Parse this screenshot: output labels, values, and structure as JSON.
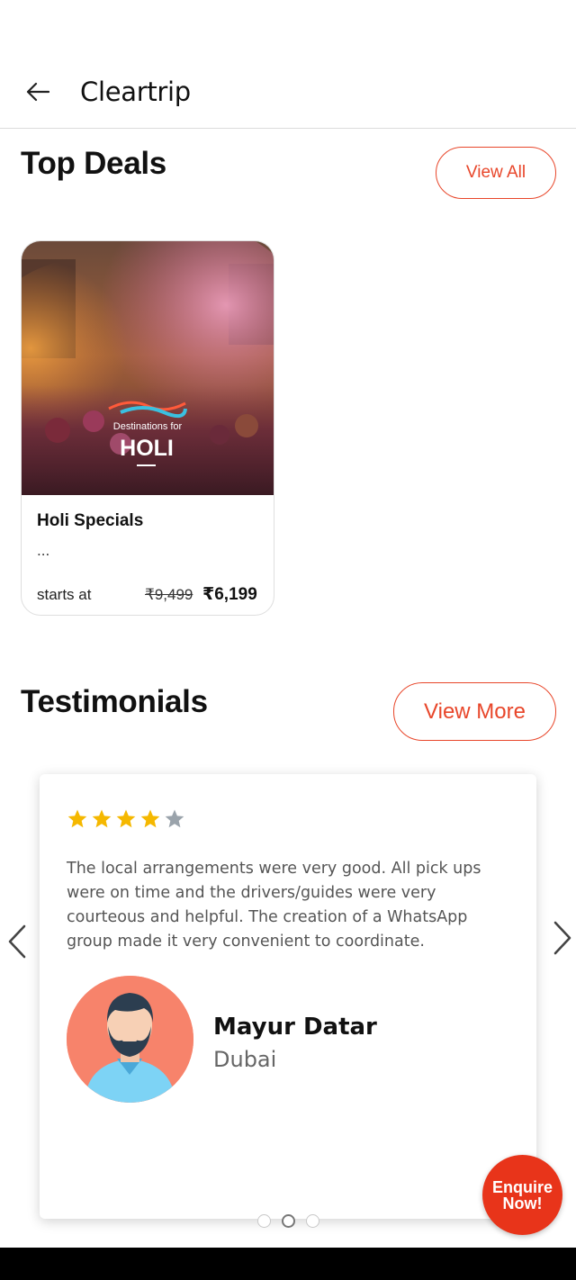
{
  "header": {
    "title": "Cleartrip"
  },
  "top_deals": {
    "title": "Top Deals",
    "view_all_label": "View All",
    "deals": [
      {
        "image_caption_small": "Destinations for",
        "image_caption_large": "HOLI",
        "name": "Holi Specials",
        "description": "...",
        "starts_label": "starts at",
        "old_price": "₹9,499",
        "new_price": "₹6,199"
      }
    ]
  },
  "testimonials": {
    "title": "Testimonials",
    "view_more_label": "View More",
    "current": {
      "rating": 4,
      "max_rating": 5,
      "text": "The local arrangements were very good. All pick ups were on time and the drivers/guides were very courteous and helpful. The creation of a WhatsApp group made it very convenient to coordinate.",
      "name": "Mayur Datar",
      "city": "Dubai"
    },
    "pagination": {
      "total": 3,
      "active_index": 1
    }
  },
  "enquire": {
    "line1": "Enquire",
    "line2": "Now!"
  },
  "colors": {
    "accent": "#e8462a",
    "star_filled": "#f5b800",
    "star_empty": "#9aa3ab",
    "avatar_bg": "#f7836b"
  },
  "icons": [
    "back-arrow-icon",
    "star-icon",
    "chevron-left-icon",
    "chevron-right-icon",
    "avatar-icon"
  ]
}
